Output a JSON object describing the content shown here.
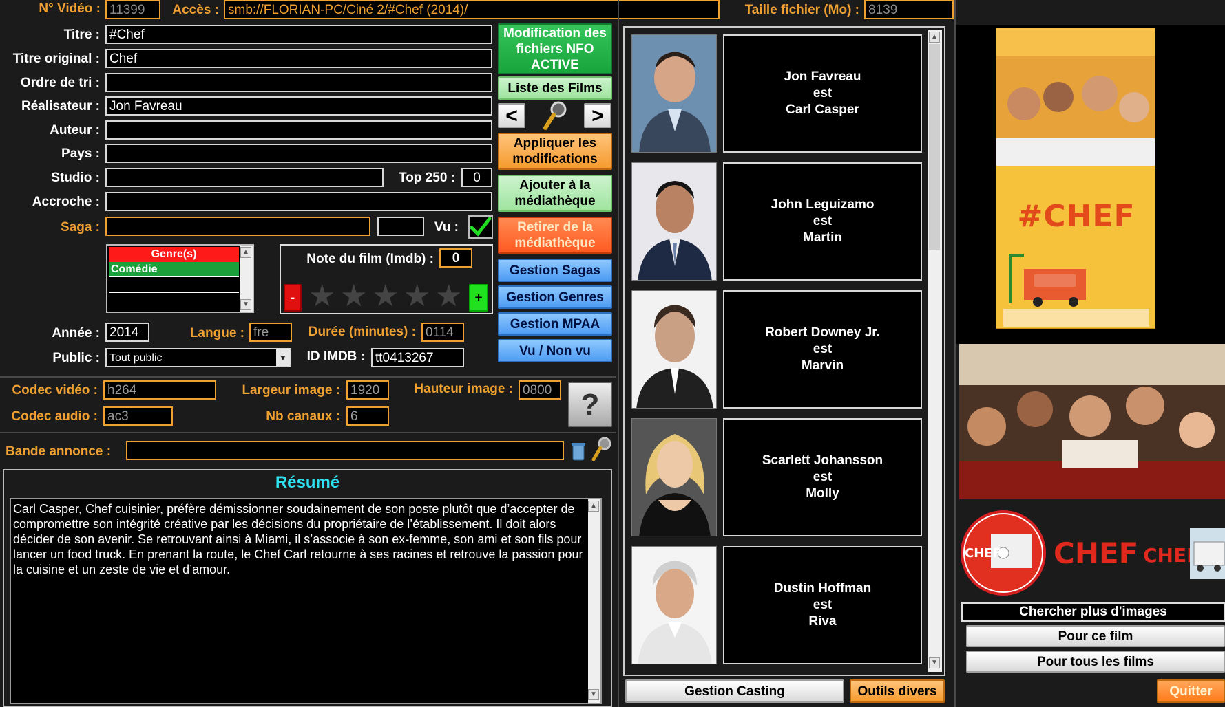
{
  "top": {
    "video_no_label": "N° Vidéo :",
    "video_no_value": "11399",
    "access_label": "Accès :",
    "access_value": "smb://FLORIAN-PC/Ciné 2/#Chef (2014)/",
    "filesize_label": "Taille fichier (Mo) :",
    "filesize_value": "8139"
  },
  "fields": {
    "titre_label": "Titre :",
    "titre_value": "#Chef",
    "titre_orig_label": "Titre original :",
    "titre_orig_value": "Chef",
    "ordre_label": "Ordre de tri :",
    "ordre_value": "",
    "realisateur_label": "Réalisateur :",
    "realisateur_value": "Jon Favreau",
    "auteur_label": "Auteur :",
    "auteur_value": "",
    "pays_label": "Pays :",
    "pays_value": "",
    "studio_label": "Studio :",
    "studio_value": "",
    "top250_label": "Top 250 :",
    "top250_value": "0",
    "accroche_label": "Accroche :",
    "accroche_value": "",
    "saga_label": "Saga :",
    "saga_value": "",
    "saga_extra": "",
    "vu_label": "Vu :",
    "annee_label": "Année :",
    "annee_value": "2014",
    "langue_label": "Langue :",
    "langue_value": "fre",
    "duree_label": "Durée (minutes) :",
    "duree_value": "0114",
    "public_label": "Public :",
    "public_value": "Tout public",
    "imdb_label": "ID IMDB :",
    "imdb_value": "tt0413267"
  },
  "genres": {
    "header": "Genre(s)",
    "items": [
      "Comédie",
      "",
      ""
    ]
  },
  "rating": {
    "label": "Note du film (Imdb) :",
    "value": "0",
    "stars_filled": 0,
    "stars_total": 5,
    "minus": "-",
    "plus": "+"
  },
  "tech": {
    "codec_video_label": "Codec vidéo :",
    "codec_video_value": "h264",
    "codec_audio_label": "Codec audio :",
    "codec_audio_value": "ac3",
    "largeur_label": "Largeur image :",
    "largeur_value": "1920",
    "hauteur_label": "Hauteur image :",
    "hauteur_value": "0800",
    "canaux_label": "Nb canaux :",
    "canaux_value": "6",
    "help": "?"
  },
  "trailer": {
    "label": "Bande annonce :",
    "value": ""
  },
  "resume": {
    "title": "Résumé",
    "text": "Carl Casper, Chef cuisinier, préfère démissionner soudainement de son poste plutôt que d’accepter de compromettre son intégrité créative par les décisions du propriétaire de l’établissement. Il doit alors décider de son avenir. Se retrouvant ainsi à Miami, il s’associe à son ex-femme, son ami et son fils pour lancer un food truck. En prenant la route, le Chef Carl retourne à ses racines et retrouve la passion pour la cuisine et un zeste de vie et d’amour."
  },
  "buttons": {
    "nfo": "Modification des fichiers NFO ACTIVE",
    "liste": "Liste des Films",
    "prev": "<",
    "next": ">",
    "appliquer": "Appliquer les modifications",
    "ajouter": "Ajouter à la médiathèque",
    "retirer": "Retirer de la médiathèque",
    "sagas": "Gestion Sagas",
    "genres": "Gestion Genres",
    "mpaa": "Gestion MPAA",
    "vu": "Vu / Non vu",
    "casting": "Gestion Casting",
    "outils": "Outils divers",
    "chercher": "Chercher plus d'images",
    "pour_film": "Pour ce film",
    "pour_tous": "Pour tous les films",
    "quitter": "Quitter"
  },
  "cast": [
    {
      "actor": "Jon Favreau",
      "est": "est",
      "role": "Carl Casper"
    },
    {
      "actor": "John Leguizamo",
      "est": "est",
      "role": "Martin"
    },
    {
      "actor": "Robert Downey Jr.",
      "est": "est",
      "role": "Marvin"
    },
    {
      "actor": "Scarlett Johansson",
      "est": "est",
      "role": "Molly"
    },
    {
      "actor": "Dustin Hoffman",
      "est": "est",
      "role": "Riva"
    }
  ],
  "poster": {
    "title_art": "#CHEF",
    "logo_text_1": "CHEF",
    "logo_text_2": "CHEF",
    "logo_text_3": "CHEF"
  },
  "colors": {
    "accent_orange": "#f0a030",
    "title_cyan": "#2fe0f0",
    "green_button": "#17a53c",
    "blue_button": "#4d9cf3",
    "genre_header_red": "#ff1a1a",
    "genre_selected_green": "#1ba03a"
  }
}
